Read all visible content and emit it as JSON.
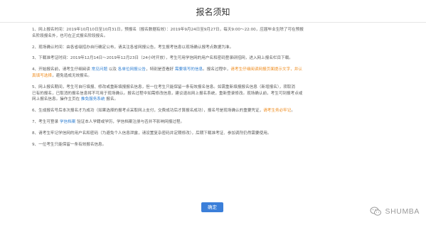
{
  "dialog": {
    "title": "报名须知",
    "confirm_label": "确定"
  },
  "items": [
    {
      "seg": [
        {
          "t": "1、网上报名时间：2019年10月10日至10月31日，预报名（报名数据有效）：2019年9月24日至9月27日，每天9:00～22:00，应届毕业生除了可在预报",
          "c": ""
        },
        {
          "t": "名阶段报名外，也可在正式报名阶段报名。",
          "c": "",
          "br": true
        }
      ]
    },
    {
      "seg": [
        {
          "t": "2、现场确认时间：由各省级招办自行确定公布，请关注各省网报公告，考生报考信息以现场确认报考点数据为准。",
          "c": ""
        }
      ]
    },
    {
      "seg": [
        {
          "t": "3、下载准考证时间：2019年12月14日～2019年12月23日（24小时开放），考生可用学信网的用户名和密码登录研招网，进入网上报名栏目下载。",
          "c": ""
        }
      ]
    },
    {
      "seg": [
        {
          "t": "4、开始报名前，请考生仔细阅读 ",
          "c": ""
        },
        {
          "t": "常见问题",
          "c": "blue"
        },
        {
          "t": " 以及 ",
          "c": ""
        },
        {
          "t": "各单位网报公告",
          "c": "blue"
        },
        {
          "t": "，特别是查看好 ",
          "c": ""
        },
        {
          "t": "需要填写的信息",
          "c": "blue"
        },
        {
          "t": "。报名过程中，",
          "c": ""
        },
        {
          "t": "请考生仔细阅读网报页面提示文字，并认",
          "c": "orange"
        },
        {
          "t": "真填写选择",
          "c": "orange",
          "br": true
        },
        {
          "t": "，避免造成无效报名。",
          "c": ""
        }
      ]
    },
    {
      "seg": [
        {
          "t": "5、网上报名期间，考生可自行填报、修改或重新填报报名信息，但一位考生只能保留一条有效报名信息。如需重新填报报名信息（新增报名），须取消",
          "c": ""
        },
        {
          "t": "已有的报名，已取消的报名信息将不可用于现场确认。报名过程中如需修改信息，建议退出网上报名系统，重新登录修改。现场确认前，考生可到报考点或",
          "c": "",
          "br": true
        },
        {
          "t": "网上报名信息。操作主页在 ",
          "c": "",
          "br": true
        },
        {
          "t": "推免服务系统",
          "c": "blue"
        },
        {
          "t": " 报名。",
          "c": ""
        }
      ]
    },
    {
      "seg": [
        {
          "t": "6、生成报名号后本次报名才为成功（如果选择的报考点采取网上支付，交费成功后才算报名成功），报名号是现场确认的重要凭证，",
          "c": ""
        },
        {
          "t": "请考生务必牢记",
          "c": "orange"
        },
        {
          "t": "。",
          "c": ""
        }
      ]
    },
    {
      "seg": [
        {
          "t": "7、考生可登录 ",
          "c": ""
        },
        {
          "t": "学信档案",
          "c": "blue"
        },
        {
          "t": " 验证本人学籍或学历，学信档案注册与否并不影响网报过程。",
          "c": ""
        }
      ]
    },
    {
      "seg": [
        {
          "t": "8、请考生牢记学信网的用户名和密码（为避免个人信息泄露，请设置复杂密码并定期修改），后期下载准考证、参加调剂仍然需要使用。",
          "c": ""
        }
      ]
    },
    {
      "seg": [
        {
          "t": "9、一位考生只能保留一条有效报名信息。",
          "c": ""
        }
      ]
    }
  ],
  "watermark": {
    "text": "SHUMBA",
    "icon": "wechat-icon"
  },
  "colors": {
    "link": "#2f7fd2",
    "warning": "#ee8a1b",
    "primary_button": "#3b7fd9"
  }
}
